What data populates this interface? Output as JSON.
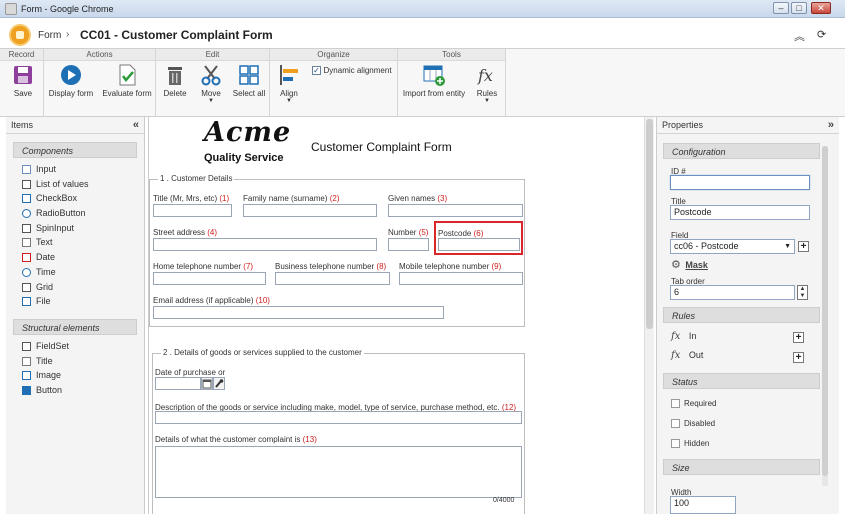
{
  "window": {
    "title": "Form - Google Chrome"
  },
  "header": {
    "breadcrumb_root": "Form",
    "separator": "›",
    "page_title": "CC01 - Customer Complaint Form"
  },
  "ribbon": {
    "groups": {
      "record": "Record",
      "actions": "Actions",
      "edit": "Edit",
      "organize": "Organize",
      "tools": "Tools"
    },
    "buttons": {
      "save": "Save",
      "display_form": "Display form",
      "evaluate_form": "Evaluate form",
      "delete": "Delete",
      "move": "Move",
      "select_all": "Select all",
      "align": "Align",
      "dynamic_alignment": "Dynamic alignment",
      "import_from_entity": "Import from entity",
      "rules": "Rules"
    },
    "dynamic_alignment_checked": true
  },
  "items_panel": {
    "title": "Items",
    "components_title": "Components",
    "components": [
      "Input",
      "List of values",
      "CheckBox",
      "RadioButton",
      "SpinInput",
      "Text",
      "Date",
      "Time",
      "Grid",
      "File"
    ],
    "structural_title": "Structural elements",
    "structural": [
      "FieldSet",
      "Title",
      "Image",
      "Button"
    ]
  },
  "form": {
    "logo_text": "Acme",
    "logo_sub": "Quality Service",
    "title": "Customer Complaint Form",
    "section1": "1 . Customer Details",
    "fields1": {
      "title_label": "Title (Mr, Mrs, etc)",
      "title_num": "(1)",
      "family_label": "Family name (surname)",
      "family_num": "(2)",
      "given_label": "Given names",
      "given_num": "(3)",
      "street_label": "Street address",
      "street_num": "(4)",
      "number_label": "Number",
      "number_num": "(5)",
      "postcode_label": "Postcode",
      "postcode_num": "(6)",
      "home_label": "Home telephone number",
      "home_num": "(7)",
      "business_label": "Business telephone number",
      "business_num": "(8)",
      "mobile_label": "Mobile telephone number",
      "mobile_num": "(9)",
      "email_label": "Email address (if applicable)",
      "email_num": "(10)"
    },
    "section2": "2 . Details of goods or services supplied to the customer",
    "fields2": {
      "purchase_label": "Date of purchase or",
      "desc_label": "Description of the goods or service including make, model, type of service, purchase method, etc.",
      "desc_num": "(12)",
      "details_label": "Details of what the customer complaint is",
      "details_num": "(13)",
      "counter": "0/4000"
    }
  },
  "props_panel": {
    "title": "Properties",
    "configuration": "Configuration",
    "id_label": "ID #",
    "id_value": "",
    "title_label": "Title",
    "title_value": "Postcode",
    "field_label": "Field",
    "field_value": "cc06 - Postcode",
    "mask_label": "Mask",
    "tab_order_label": "Tab order",
    "tab_order_value": "6",
    "rules": "Rules",
    "rule_in": "In",
    "rule_out": "Out",
    "status": "Status",
    "required": "Required",
    "disabled": "Disabled",
    "hidden": "Hidden",
    "size": "Size",
    "width_label": "Width",
    "width_value": "100"
  },
  "colors": {
    "accent": "#1f6fb5",
    "selection": "#d9262a",
    "required_num": "#d02020"
  }
}
